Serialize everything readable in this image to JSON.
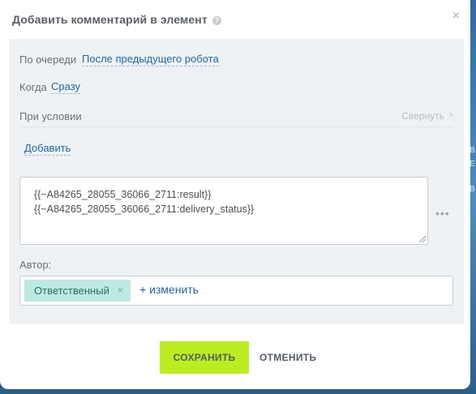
{
  "dialog": {
    "title": "Добавить комментарий в элемент",
    "help_icon": "?",
    "close_icon": "×"
  },
  "fields": {
    "order_label": "По очереди",
    "order_value": "После предыдущего робота",
    "when_label": "Когда",
    "when_value": "Сразу",
    "condition_label": "При условии",
    "collapse_label": "Свернуть",
    "add_link": "Добавить",
    "comment_line1": "{{~A84265_28055_36066_2711:result}}",
    "comment_line2": "{{~A84265_28055_36066_2711:delivery_status}}",
    "more_icon": "•••",
    "author_label": "Автор:",
    "author_tag": "Ответственный",
    "author_tag_remove": "×",
    "change_link": "+ изменить"
  },
  "buttons": {
    "save": "СОХРАНИТЬ",
    "cancel": "ОТМЕНИТЬ"
  },
  "background": {
    "side_marks": [
      "В",
      "Е",
      "В"
    ]
  },
  "colors": {
    "accent_green": "#bbed21",
    "link_blue": "#2067b0",
    "tag_bg": "#bde9e3",
    "panel_bg": "#eef2f4"
  }
}
